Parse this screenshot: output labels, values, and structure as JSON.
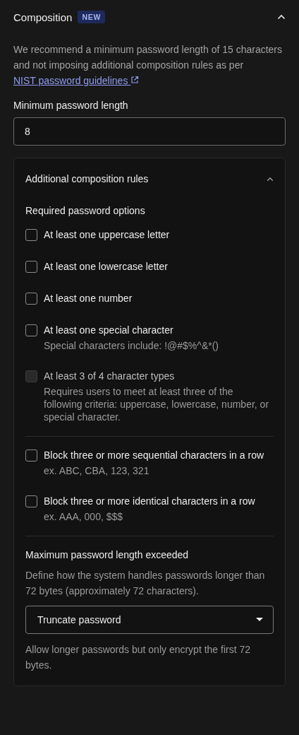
{
  "section": {
    "title": "Composition",
    "badge": "NEW",
    "expanded": true
  },
  "description": {
    "text": "We recommend a minimum password length of 15 characters and not imposing additional composition rules as per ",
    "link": "NIST password guidelines"
  },
  "min_length": {
    "label": "Minimum password length",
    "value": "8"
  },
  "rules_panel": {
    "title": "Additional composition rules",
    "expanded": true,
    "options_heading": "Required password options",
    "option_groups": [
      {
        "options": [
          {
            "label": "At least one uppercase letter",
            "checked": false,
            "disabled": false
          },
          {
            "label": "At least one lowercase letter",
            "checked": false,
            "disabled": false
          },
          {
            "label": "At least one number",
            "checked": false,
            "disabled": false
          },
          {
            "label": "At least one special character",
            "hint": "Special characters include: !@#$%^&*()",
            "checked": false,
            "disabled": false
          },
          {
            "label": "At least 3 of 4 character types",
            "hint": "Requires users to meet at least three of the following criteria: uppercase, lowercase, number, or special character.",
            "checked": false,
            "disabled": true
          }
        ]
      },
      {
        "options": [
          {
            "label": "Block three or more sequential characters in a row",
            "hint": "ex. ABC, CBA, 123, 321",
            "checked": false,
            "disabled": false
          },
          {
            "label": "Block three or more identical characters in a row",
            "hint": "ex. AAA, 000, $$$",
            "checked": false,
            "disabled": false
          }
        ]
      }
    ],
    "max_length": {
      "title": "Maximum password length exceeded",
      "description": "Define how the system handles passwords longer than 72 bytes (approximately 72 characters).",
      "select_value": "Truncate password",
      "help": "Allow longer passwords but only encrypt the first 72 bytes."
    }
  }
}
